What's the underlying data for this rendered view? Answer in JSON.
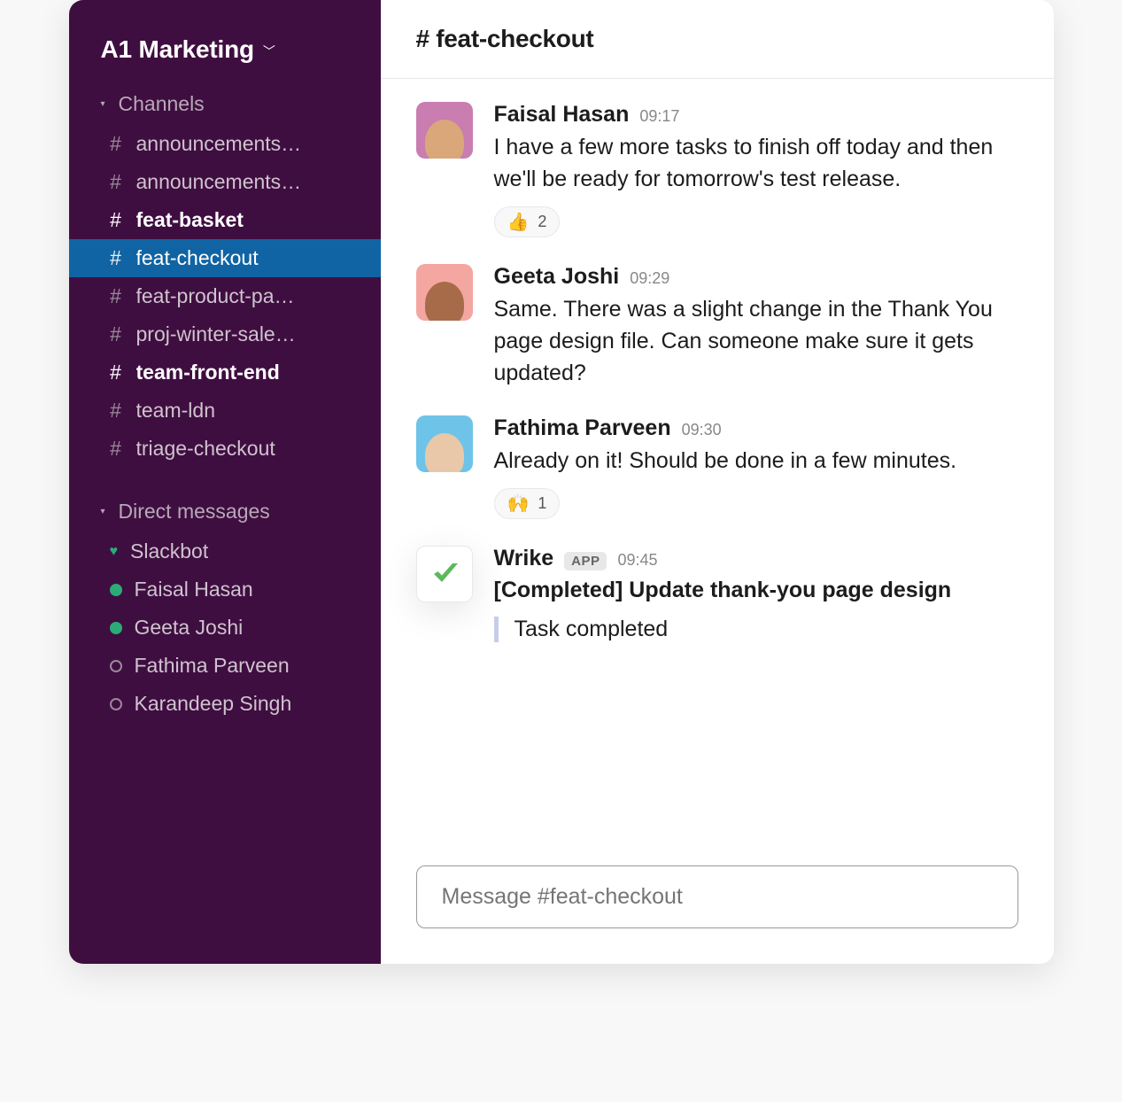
{
  "workspace": {
    "name": "A1 Marketing"
  },
  "sidebar": {
    "channels_label": "Channels",
    "dm_label": "Direct messages",
    "channels": [
      {
        "name": "announcements…",
        "bold": false,
        "active": false
      },
      {
        "name": "announcements…",
        "bold": false,
        "active": false
      },
      {
        "name": "feat-basket",
        "bold": true,
        "active": false
      },
      {
        "name": "feat-checkout",
        "bold": false,
        "active": true
      },
      {
        "name": "feat-product-pa…",
        "bold": false,
        "active": false
      },
      {
        "name": "proj-winter-sale…",
        "bold": false,
        "active": false
      },
      {
        "name": "team-front-end",
        "bold": true,
        "active": false
      },
      {
        "name": "team-ldn",
        "bold": false,
        "active": false
      },
      {
        "name": "triage-checkout",
        "bold": false,
        "active": false
      }
    ],
    "dms": [
      {
        "name": "Slackbot",
        "presence": "heart"
      },
      {
        "name": "Faisal Hasan",
        "presence": "active"
      },
      {
        "name": "Geeta Joshi",
        "presence": "active"
      },
      {
        "name": "Fathima Parveen",
        "presence": "away"
      },
      {
        "name": "Karandeep Singh",
        "presence": "away"
      }
    ]
  },
  "header": {
    "channel_title": "# feat-checkout"
  },
  "messages": [
    {
      "author": "Faisal Hasan",
      "time": "09:17",
      "text": "I have a few more tasks to finish off today and then we'll be ready for tomorrow's test release.",
      "avatar": "photo1",
      "reactions": [
        {
          "emoji": "👍",
          "count": "2"
        }
      ]
    },
    {
      "author": "Geeta Joshi",
      "time": "09:29",
      "text": "Same. There was a slight change in the Thank You page design file. Can someone make sure it gets updated?",
      "avatar": "photo2",
      "reactions": []
    },
    {
      "author": "Fathima Parveen",
      "time": "09:30",
      "text": "Already on it! Should be done in a few minutes.",
      "avatar": "photo3",
      "reactions": [
        {
          "emoji": "🙌",
          "count": "1"
        }
      ]
    },
    {
      "author": "Wrike",
      "time": "09:45",
      "is_app": true,
      "app_badge": "APP",
      "title": "[Completed] Update thank-you page design",
      "attachment": "Task completed",
      "avatar": "app",
      "reactions": []
    }
  ],
  "composer": {
    "placeholder": "Message #feat-checkout"
  }
}
